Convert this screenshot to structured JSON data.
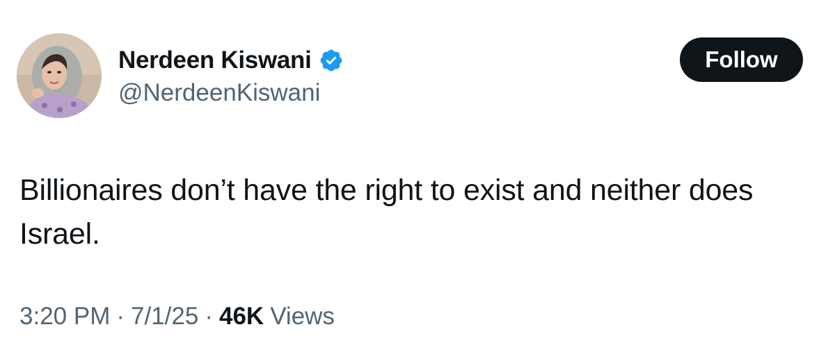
{
  "author": {
    "display_name": "Nerdeen Kiswani",
    "handle": "@NerdeenKiswani",
    "verified": true,
    "verified_color": "#1d9bf0"
  },
  "follow_button": {
    "label": "Follow"
  },
  "tweet": {
    "text": "Billionaires don’t have the right to exist and neither does Israel."
  },
  "meta": {
    "time": "3:20 PM",
    "separator": "·",
    "date": "7/1/25",
    "views_count": "46K",
    "views_label": "Views"
  },
  "icons": {
    "verified": "verified-badge-icon",
    "avatar": "profile-photo"
  }
}
